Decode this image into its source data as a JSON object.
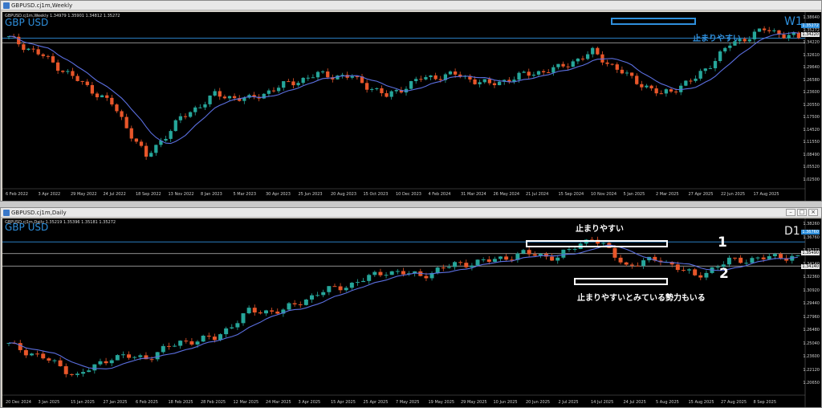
{
  "weekly": {
    "title": "GBPUSD.cj1m,Weekly",
    "ohlc": "GBPUSD.cj1m,Weekly  1.34979 1.35901 1.34812 1.35272",
    "symbol": "GBP USD",
    "timeframe": "W1",
    "annotation": "止まりやすい",
    "price_labels": [
      "1.38640",
      "1.35272",
      "1.34220",
      "1.32610",
      "1.29640",
      "1.26580",
      "1.23600",
      "1.20550",
      "1.17500",
      "1.14520",
      "1.11550",
      "1.08490",
      "1.05520",
      "1.02500"
    ],
    "date_labels": [
      "6 Feb 2022",
      "3 Apr 2022",
      "29 May 2022",
      "24 Jul 2022",
      "18 Sep 2022",
      "13 Nov 2022",
      "8 Jan 2023",
      "5 Mar 2023",
      "30 Apr 2023",
      "25 Jun 2023",
      "20 Aug 2023",
      "15 Oct 2023",
      "10 Dec 2023",
      "4 Feb 2024",
      "31 Mar 2024",
      "26 May 2024",
      "21 Jul 2024",
      "15 Sep 2024",
      "10 Nov 2024",
      "5 Jan 2025",
      "2 Mar 2025",
      "27 Apr 2025",
      "22 Jun 2025",
      "17 Aug 2025"
    ],
    "close_label": "1.35272",
    "level_label": "1.34220"
  },
  "daily": {
    "title": "GBPUSD.cj1m,Daily",
    "ohlc": "GBPUSD.cj1m,Daily  1.35219 1.35396 1.35181 1.35272",
    "symbol": "GBP USD",
    "timeframe": "D1",
    "annotation_top": "止まりやすい",
    "annotation_bottom": "止まりやすいとみている勢力もいる",
    "label1": "1",
    "label2": "2",
    "price_labels": [
      "1.38260",
      "1.36760",
      "1.35272",
      "1.34140",
      "1.32360",
      "1.30920",
      "1.29440",
      "1.27960",
      "1.26480",
      "1.25040",
      "1.23600",
      "1.22120",
      "1.20650"
    ],
    "date_labels": [
      "20 Dec 2024",
      "3 Jan 2025",
      "15 Jan 2025",
      "27 Jan 2025",
      "6 Feb 2025",
      "18 Feb 2025",
      "28 Feb 2025",
      "12 Mar 2025",
      "24 Mar 2025",
      "3 Apr 2025",
      "15 Apr 2025",
      "25 Apr 2025",
      "7 May 2025",
      "19 May 2025",
      "29 May 2025",
      "10 Jun 2025",
      "20 Jun 2025",
      "2 Jul 2025",
      "14 Jul 2025",
      "24 Jul 2025",
      "5 Aug 2025",
      "15 Aug 2025",
      "27 Aug 2025",
      "8 Sep 2025"
    ],
    "close_label": "1.35272",
    "level_label": "1.34140",
    "level1_label": "1.35490"
  },
  "colors": {
    "up": "#26a69a",
    "down": "#e8562a",
    "ma": "#5b6fe0",
    "accent": "#2f8fdc"
  },
  "chart_data": [
    {
      "type": "candlestick",
      "title": "GBPUSD.cj1m,Weekly",
      "timeframe": "W1",
      "ylim": [
        1.025,
        1.386
      ],
      "x": [
        "6 Feb 2022",
        "3 Apr 2022",
        "29 May 2022",
        "24 Jul 2022",
        "18 Sep 2022",
        "13 Nov 2022",
        "8 Jan 2023",
        "5 Mar 2023",
        "30 Apr 2023",
        "25 Jun 2023",
        "20 Aug 2023",
        "15 Oct 2023",
        "10 Dec 2023",
        "4 Feb 2024",
        "31 Mar 2024",
        "26 May 2024",
        "21 Jul 2024",
        "15 Sep 2024",
        "10 Nov 2024",
        "5 Jan 2025",
        "2 Mar 2025",
        "27 Apr 2025",
        "22 Jun 2025",
        "17 Aug 2025"
      ],
      "close": [
        1.353,
        1.312,
        1.258,
        1.205,
        1.085,
        1.172,
        1.225,
        1.215,
        1.247,
        1.271,
        1.265,
        1.222,
        1.262,
        1.271,
        1.248,
        1.27,
        1.285,
        1.321,
        1.268,
        1.225,
        1.262,
        1.338,
        1.372,
        1.353
      ],
      "horizontal_levels": [
        1.3527,
        1.3422
      ]
    },
    {
      "type": "candlestick",
      "title": "GBPUSD.cj1m,Daily",
      "timeframe": "D1",
      "ylim": [
        1.2065,
        1.3826
      ],
      "x": [
        "20 Dec 2024",
        "3 Jan 2025",
        "15 Jan 2025",
        "27 Jan 2025",
        "6 Feb 2025",
        "18 Feb 2025",
        "28 Feb 2025",
        "12 Mar 2025",
        "24 Mar 2025",
        "3 Apr 2025",
        "15 Apr 2025",
        "25 Apr 2025",
        "7 May 2025",
        "19 May 2025",
        "29 May 2025",
        "10 Jun 2025",
        "20 Jun 2025",
        "2 Jul 2025",
        "14 Jul 2025",
        "24 Jul 2025",
        "5 Aug 2025",
        "15 Aug 2025",
        "27 Aug 2025",
        "8 Sep 2025"
      ],
      "close": [
        1.256,
        1.242,
        1.222,
        1.243,
        1.242,
        1.259,
        1.263,
        1.292,
        1.293,
        1.312,
        1.322,
        1.336,
        1.331,
        1.343,
        1.347,
        1.355,
        1.351,
        1.373,
        1.342,
        1.349,
        1.33,
        1.347,
        1.35,
        1.353
      ],
      "horizontal_levels": [
        1.3676,
        1.3549,
        1.3414
      ]
    }
  ]
}
